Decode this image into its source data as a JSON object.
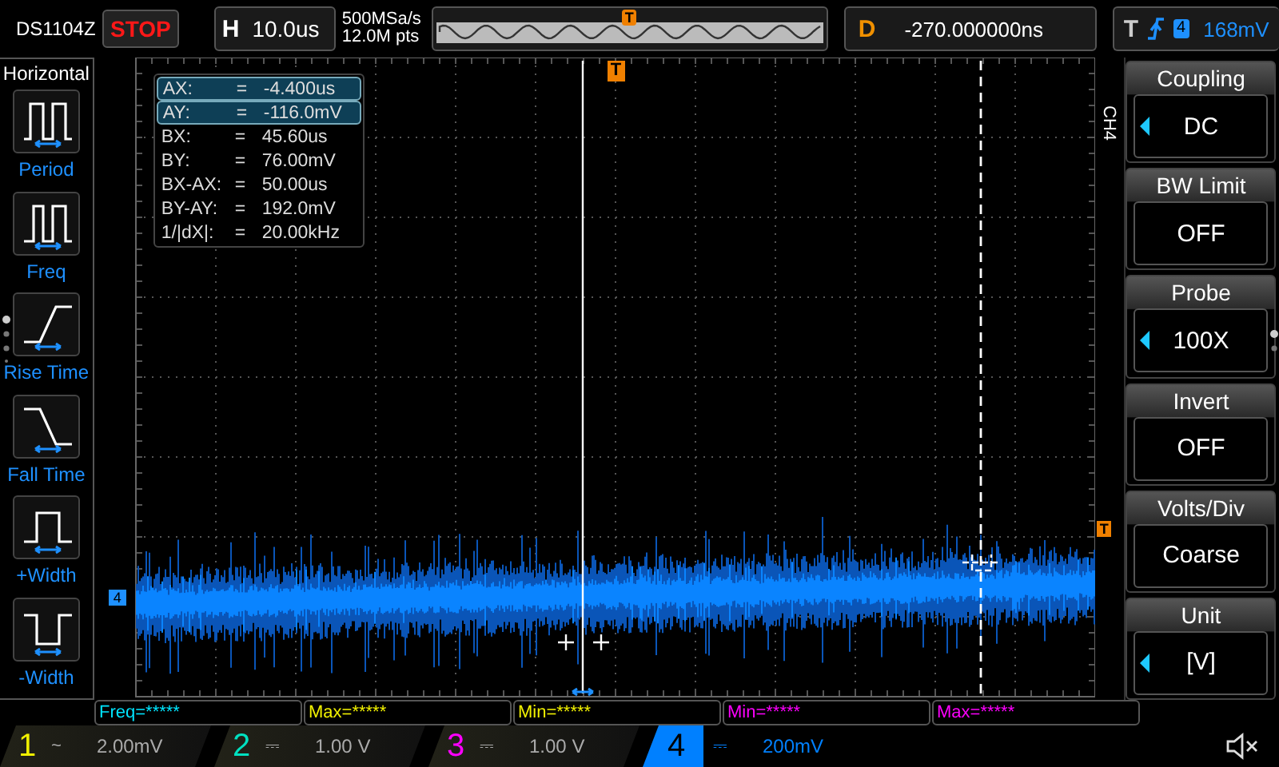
{
  "model": "DS1104Z",
  "run_state": "STOP",
  "horizontal": {
    "label": "H",
    "timebase": "10.0us"
  },
  "acquisition": {
    "sample_rate": "500MSa/s",
    "memory_depth": "12.0M pts"
  },
  "overview": {
    "trigger_mark": "T"
  },
  "delay": {
    "label": "D",
    "value": "-270.000000ns"
  },
  "trigger": {
    "label": "T",
    "channel": "4",
    "level": "168mV"
  },
  "measure_menu": {
    "title": "Horizontal",
    "items": [
      {
        "label": "Period",
        "kind": "period"
      },
      {
        "label": "Freq",
        "kind": "freq"
      },
      {
        "label": "Rise Time",
        "kind": "rise"
      },
      {
        "label": "Fall Time",
        "kind": "fall"
      },
      {
        "label": "+Width",
        "kind": "pwidth"
      },
      {
        "label": "-Width",
        "kind": "nwidth"
      }
    ]
  },
  "cursor_readout": [
    {
      "name": "AX:",
      "sep": "=",
      "value": "-4.400us",
      "selected": true
    },
    {
      "name": "AY:",
      "sep": "=",
      "value": "-116.0mV",
      "selected": true
    },
    {
      "name": "BX:",
      "sep": "=",
      "value": "45.60us",
      "selected": false
    },
    {
      "name": "BY:",
      "sep": "=",
      "value": "76.00mV",
      "selected": false
    },
    {
      "name": "BX-AX:",
      "sep": "=",
      "value": "50.00us",
      "selected": false
    },
    {
      "name": "BY-AY:",
      "sep": "=",
      "value": "192.0mV",
      "selected": false
    },
    {
      "name": "1/|dX|:",
      "sep": "=",
      "value": "20.00kHz",
      "selected": false
    }
  ],
  "plot": {
    "top_trigger_mark": "T",
    "level_mark": "T",
    "channel_mark": "4"
  },
  "side_menu": {
    "channel": "CH4",
    "items": [
      {
        "title": "Coupling",
        "value": "DC",
        "adjustable": true
      },
      {
        "title": "BW Limit",
        "value": "OFF",
        "adjustable": false
      },
      {
        "title": "Probe",
        "value": "100X",
        "adjustable": true
      },
      {
        "title": "Invert",
        "value": "OFF",
        "adjustable": false
      },
      {
        "title": "Volts/Div",
        "value": "Coarse",
        "adjustable": false
      },
      {
        "title": "Unit",
        "value": "[V]",
        "adjustable": true
      }
    ]
  },
  "measurements": [
    {
      "text": "Freq=*****",
      "color": "#00e5ff"
    },
    {
      "text": "Max=*****",
      "color": "#f0f000"
    },
    {
      "text": "Min=*****",
      "color": "#f0f000"
    },
    {
      "text": "Min=*****",
      "color": "#ff00ff"
    },
    {
      "text": "Max=*****",
      "color": "#ff00ff"
    }
  ],
  "channels": [
    {
      "number": "1",
      "coupling": "~",
      "scale": "2.00mV",
      "selected": false,
      "color": "#f0f000"
    },
    {
      "number": "2",
      "coupling": "⎓",
      "scale": "1.00 V",
      "selected": false,
      "color": "#00e0c0"
    },
    {
      "number": "3",
      "coupling": "⎓",
      "scale": "1.00 V",
      "selected": false,
      "color": "#ff00ff"
    },
    {
      "number": "4",
      "coupling": "⎓",
      "scale": "200mV",
      "selected": true,
      "color": "#0080ff"
    }
  ]
}
